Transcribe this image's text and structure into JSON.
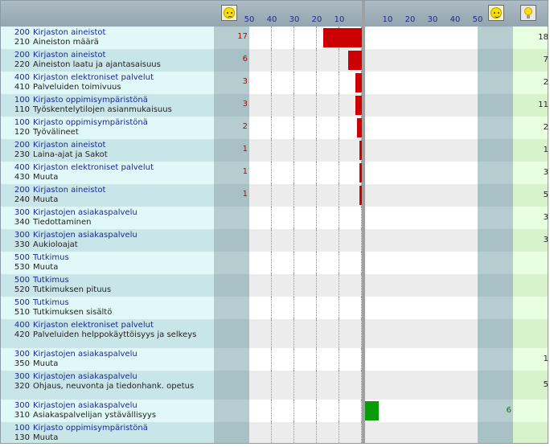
{
  "scales": {
    "left": [
      "50",
      "40",
      "30",
      "20",
      "10"
    ],
    "right": [
      "10",
      "20",
      "30",
      "40",
      "50"
    ]
  },
  "icons": {
    "negative": "sad-face-icon",
    "positive": "happy-face-icon",
    "ideas": "lightbulb-icon"
  },
  "colors": {
    "negative_bar": "#cc0000",
    "positive_bar": "#0a9a0a",
    "label_blue": "#1a2a8c"
  },
  "chart_data": {
    "type": "bar",
    "axis_left": {
      "range": [
        0,
        50
      ],
      "direction": "leftward"
    },
    "axis_right": {
      "range": [
        0,
        50
      ],
      "direction": "rightward"
    },
    "rows": [
      {
        "cat_code": "200",
        "cat": "Kirjaston aineistot",
        "sub_code": "210",
        "sub": "Aineiston määrä",
        "negative": "17",
        "positive": "",
        "ideas": "18"
      },
      {
        "cat_code": "200",
        "cat": "Kirjaston aineistot",
        "sub_code": "220",
        "sub": "Aineiston laatu ja ajantasaisuus",
        "negative": "6",
        "positive": "",
        "ideas": "7"
      },
      {
        "cat_code": "400",
        "cat": "Kirjaston elektroniset palvelut",
        "sub_code": "410",
        "sub": "Palveluiden toimivuus",
        "negative": "3",
        "positive": "",
        "ideas": "2"
      },
      {
        "cat_code": "100",
        "cat": "Kirjasto oppimisympäristönä",
        "sub_code": "110",
        "sub": "Työskentelytilojen asianmukaisuus",
        "negative": "3",
        "positive": "",
        "ideas": "11"
      },
      {
        "cat_code": "100",
        "cat": "Kirjasto oppimisympäristönä",
        "sub_code": "120",
        "sub": "Työvälineet",
        "negative": "2",
        "positive": "",
        "ideas": "2"
      },
      {
        "cat_code": "200",
        "cat": "Kirjaston aineistot",
        "sub_code": "230",
        "sub": "Laina-ajat ja Sakot",
        "negative": "1",
        "positive": "",
        "ideas": "1"
      },
      {
        "cat_code": "400",
        "cat": "Kirjaston elektroniset palvelut",
        "sub_code": "430",
        "sub": "Muuta",
        "negative": "1",
        "positive": "",
        "ideas": "3"
      },
      {
        "cat_code": "200",
        "cat": "Kirjaston aineistot",
        "sub_code": "240",
        "sub": "Muuta",
        "negative": "1",
        "positive": "",
        "ideas": "5"
      },
      {
        "cat_code": "300",
        "cat": "Kirjastojen asiakaspalvelu",
        "sub_code": "340",
        "sub": "Tiedottaminen",
        "negative": "",
        "positive": "",
        "ideas": "3"
      },
      {
        "cat_code": "300",
        "cat": "Kirjastojen asiakaspalvelu",
        "sub_code": "330",
        "sub": "Aukioloajat",
        "negative": "",
        "positive": "",
        "ideas": "3"
      },
      {
        "cat_code": "500",
        "cat": "Tutkimus",
        "sub_code": "530",
        "sub": "Muuta",
        "negative": "",
        "positive": "",
        "ideas": ""
      },
      {
        "cat_code": "500",
        "cat": "Tutkimus",
        "sub_code": "520",
        "sub": "Tutkimuksen pituus",
        "negative": "",
        "positive": "",
        "ideas": ""
      },
      {
        "cat_code": "500",
        "cat": "Tutkimus",
        "sub_code": "510",
        "sub": "Tutkimuksen sisältö",
        "negative": "",
        "positive": "",
        "ideas": ""
      },
      {
        "cat_code": "400",
        "cat": "Kirjaston elektroniset palvelut",
        "sub_code": "420",
        "sub": "Palveluiden helppokäyttöisyys ja selkeys",
        "negative": "",
        "positive": "",
        "ideas": ""
      },
      {
        "cat_code": "300",
        "cat": "Kirjastojen asiakaspalvelu",
        "sub_code": "350",
        "sub": "Muuta",
        "negative": "",
        "positive": "",
        "ideas": "1"
      },
      {
        "cat_code": "300",
        "cat": "Kirjastojen asiakaspalvelu",
        "sub_code": "320",
        "sub": "Ohjaus, neuvonta ja tiedonhank. opetus",
        "negative": "",
        "positive": "",
        "ideas": "5"
      },
      {
        "cat_code": "300",
        "cat": "Kirjastojen asiakaspalvelu",
        "sub_code": "310",
        "sub": "Asiakaspalvelijan ystävällisyys",
        "negative": "",
        "positive": "6",
        "ideas": ""
      },
      {
        "cat_code": "100",
        "cat": "Kirjasto oppimisympäristönä",
        "sub_code": "130",
        "sub": "Muuta",
        "negative": "",
        "positive": "",
        "ideas": ""
      }
    ]
  }
}
